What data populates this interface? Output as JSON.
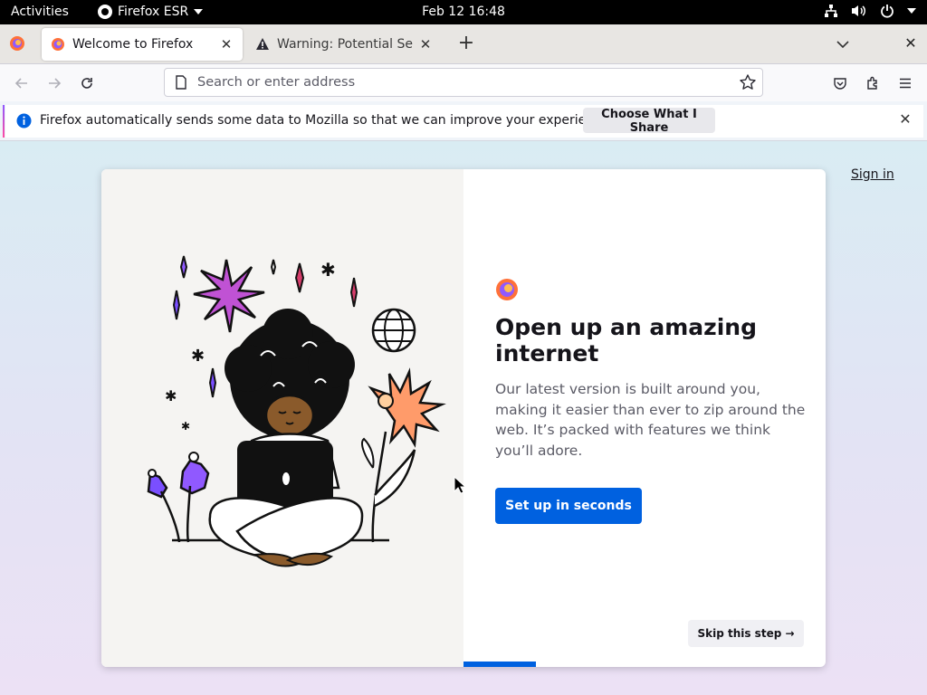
{
  "topbar": {
    "activities": "Activities",
    "app_name": "Firefox ESR",
    "clock": "Feb 12  16:48"
  },
  "tabs": [
    {
      "title": "Welcome to Firefox",
      "active": true
    },
    {
      "title": "Warning: Potential Securi",
      "active": false
    }
  ],
  "navbar": {
    "url_placeholder": "Search or enter address",
    "url_value": ""
  },
  "notification": {
    "message": "Firefox automatically sends some data to Mozilla so that we can improve your experience.",
    "button_label": "Choose What I Share"
  },
  "page": {
    "sign_in": "Sign in",
    "title": "Open up an amazing internet",
    "subtitle": "Our latest version is built around you, making it easier than ever to zip around the web. It’s packed with features we think you’ll adore.",
    "primary_button": "Set up in seconds",
    "skip_button": "Skip this step →",
    "progress_fraction": 0.2
  },
  "colors": {
    "accent": "#0061e0",
    "background_top": "#d9ecf3",
    "background_bottom": "#ece1f5"
  },
  "icons": [
    "firefox-view-icon",
    "firefox-tab-icon",
    "warning-icon",
    "back-icon",
    "forward-icon",
    "reload-icon",
    "page-icon",
    "star-icon",
    "pocket-icon",
    "extensions-icon",
    "menu-icon",
    "info-icon",
    "close-icon",
    "network-icon",
    "volume-icon",
    "power-icon"
  ]
}
